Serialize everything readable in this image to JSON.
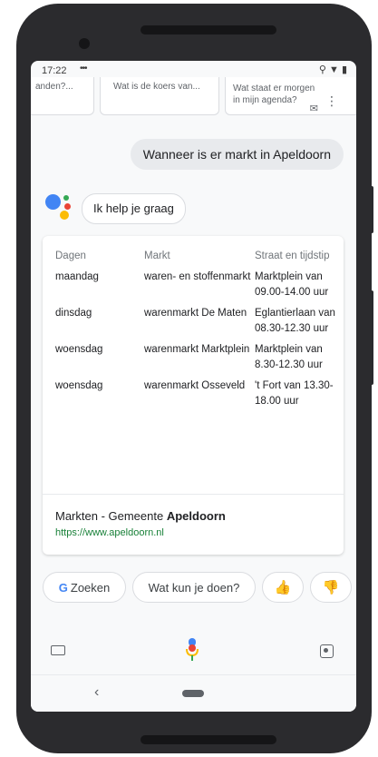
{
  "status_bar": {
    "time": "17:22",
    "dots": "•••",
    "icons": "⚲ ▼ ▮"
  },
  "suggestions": [
    {
      "label": "anden?..."
    },
    {
      "label": "Wat is de koers van..."
    },
    {
      "label": "Wat staat er morgen in mijn agenda?"
    }
  ],
  "conversation": {
    "user_query": "Wanneer is er markt in Apeldoorn",
    "assistant_reply": "Ik help je graag"
  },
  "result_card": {
    "headers": [
      "Dagen",
      "Markt",
      "Straat en tijdstip"
    ],
    "rows": [
      [
        "maandag",
        "waren- en stoffenmarkt",
        "Marktplein van 09.00-14.00 uur"
      ],
      [
        "dinsdag",
        "warenmarkt De Maten",
        "Eglantierlaan van 08.30-12.30 uur"
      ],
      [
        "woensdag",
        "warenmarkt Marktplein",
        "Marktplein van 8.30-12.30 uur"
      ],
      [
        "woensdag",
        "warenmarkt Osseveld",
        "'t Fort van 13.30-18.00 uur"
      ]
    ],
    "source_title_prefix": "Markten - Gemeente ",
    "source_title_bold": "Apeldoorn",
    "source_url": "https://www.apeldoorn.nl"
  },
  "action_chips": {
    "search_g": "G",
    "search_label": "Zoeken",
    "what_can_you_do": "Wat kun je doen?",
    "thumbs_up": "👍",
    "thumbs_down": "👎"
  },
  "colors": {
    "google_blue": "#4285f4",
    "google_red": "#ea4335",
    "google_yellow": "#fbbc05",
    "google_green": "#34a853",
    "url_green": "#188038",
    "thumb_yellow": "#f9ab00"
  },
  "nav": {
    "back": "‹"
  }
}
